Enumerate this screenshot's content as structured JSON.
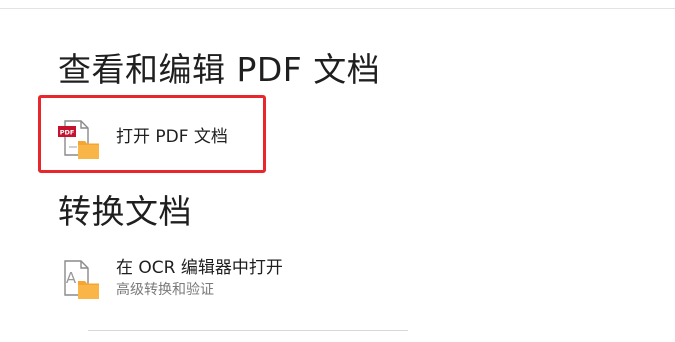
{
  "sections": {
    "view_edit": {
      "title": "查看和编辑 PDF 文档",
      "actions": [
        {
          "label": "打开 PDF 文档",
          "icon": "pdf-file-folder-icon",
          "highlighted": true
        }
      ]
    },
    "convert": {
      "title": "转换文档",
      "actions": [
        {
          "label": "在 OCR 编辑器中打开",
          "sublabel": "高级转换和验证",
          "icon": "ocr-file-folder-icon"
        }
      ]
    }
  },
  "colors": {
    "highlight": "#e8262c",
    "pdf_badge": "#c4122f",
    "folder": "#f7a531",
    "text": "#1f1f1f",
    "subtext": "#7a7a7a"
  },
  "icon_badges": {
    "pdf": "PDF",
    "ocr": "A"
  }
}
